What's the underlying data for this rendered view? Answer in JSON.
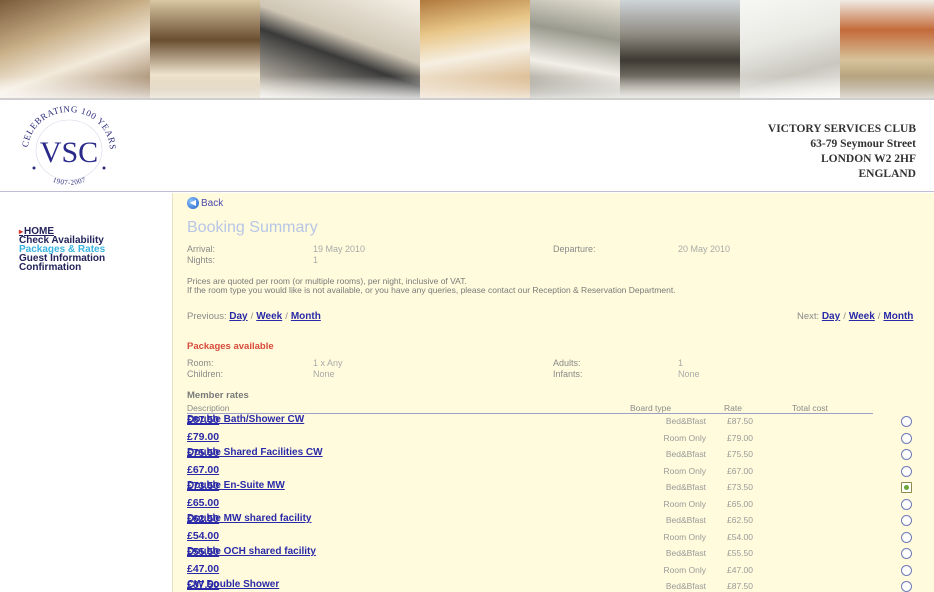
{
  "header": {
    "address": [
      "VICTORY SERVICES CLUB",
      "63-79 Seymour Street",
      "LONDON W2 2HF",
      "ENGLAND"
    ],
    "logo": {
      "arc_text": "CELEBRATING 100 YEARS",
      "monogram": "VSC",
      "years": "1907-2007"
    }
  },
  "sidebar": {
    "items": [
      {
        "label": "HOME"
      },
      {
        "label": "Check Availability"
      },
      {
        "label": "Packages & Rates"
      },
      {
        "label": "Guest Information"
      },
      {
        "label": "Confirmation"
      }
    ]
  },
  "main": {
    "back_label": "Back",
    "title": "Booking Summary",
    "arrival_label": "Arrival:",
    "arrival_value": "19 May 2010",
    "nights_label": "Nights:",
    "nights_value": "1",
    "departure_label": "Departure:",
    "departure_value": "20 May 2010",
    "notice_line1": "Prices are quoted per room (or multiple rooms), per night, inclusive of VAT.",
    "notice_line2": "If the room type you would like is not available, or you have any queries, please contact our Reception & Reservation Department.",
    "prev_label": "Previous:",
    "next_label": "Next:",
    "nav_links": {
      "day": "Day",
      "week": "Week",
      "month": "Month",
      "sep": "/"
    },
    "packages_title": "Packages available",
    "room_label": "Room:",
    "room_value": "1 x Any",
    "children_label": "Children:",
    "children_value": "None",
    "adults_label": "Adults:",
    "adults_value": "1",
    "infants_label": "Infants:",
    "infants_value": "None",
    "member_rates_title": "Member rates",
    "columns": {
      "description": "Description",
      "board_type": "Board type",
      "rate": "Rate",
      "total": "Total cost"
    },
    "rooms": [
      {
        "name": "Double Bath/Shower CW",
        "rates": [
          {
            "board": "Bed&Bfast",
            "rate": "£87.50",
            "total": "£87.50",
            "selected": false
          },
          {
            "board": "Room Only",
            "rate": "£79.00",
            "total": "£79.00",
            "selected": false
          }
        ]
      },
      {
        "name": "Double Shared Facilities CW",
        "rates": [
          {
            "board": "Bed&Bfast",
            "rate": "£75.50",
            "total": "£75.50",
            "selected": false
          },
          {
            "board": "Room Only",
            "rate": "£67.00",
            "total": "£67.00",
            "selected": false
          }
        ]
      },
      {
        "name": "Double En-Suite MW",
        "rates": [
          {
            "board": "Bed&Bfast",
            "rate": "£73.50",
            "total": "£73.50",
            "selected": true
          },
          {
            "board": "Room Only",
            "rate": "£65.00",
            "total": "£65.00",
            "selected": false
          }
        ]
      },
      {
        "name": "Double MW shared facility",
        "rates": [
          {
            "board": "Bed&Bfast",
            "rate": "£62.50",
            "total": "£62.50",
            "selected": false
          },
          {
            "board": "Room Only",
            "rate": "£54.00",
            "total": "£54.00",
            "selected": false
          }
        ]
      },
      {
        "name": "Double OCH shared facility",
        "rates": [
          {
            "board": "Bed&Bfast",
            "rate": "£55.50",
            "total": "£55.50",
            "selected": false
          },
          {
            "board": "Room Only",
            "rate": "£47.00",
            "total": "£47.00",
            "selected": false
          }
        ]
      },
      {
        "name": "CW Double Shower",
        "rates": [
          {
            "board": "Bed&Bfast",
            "rate": "£87.50",
            "total": "£87.50",
            "selected": false
          }
        ]
      }
    ]
  }
}
